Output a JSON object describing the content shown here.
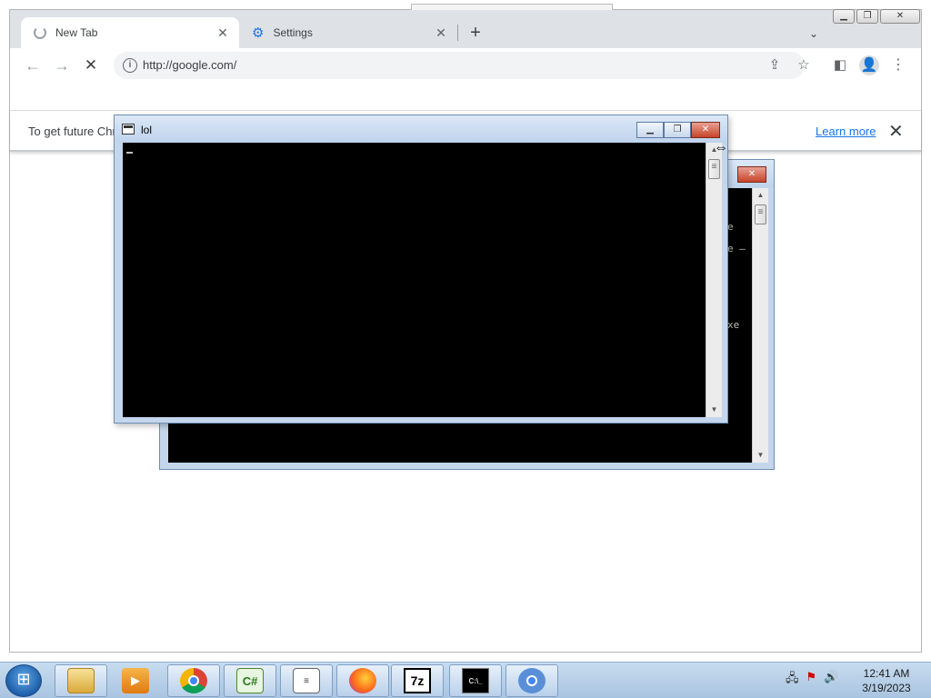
{
  "browser": {
    "tabs": [
      {
        "title": "New Tab",
        "loading": true
      },
      {
        "title": "Settings"
      }
    ],
    "url": "http://google.com/",
    "infobar": {
      "message": "To get future Chr",
      "link": "Learn more"
    }
  },
  "consoles": {
    "front": {
      "title": "lol"
    },
    "back": {
      "partial_lines": [
        "e",
        "e  —",
        "xe"
      ]
    }
  },
  "taskbar": {
    "apps": [
      "windows-explorer",
      "media-player",
      "chrome",
      "csharp-ide",
      "notepad-app",
      "firefox",
      "7zip",
      "command-prompt",
      "chromium"
    ],
    "clock": {
      "time": "12:41 AM",
      "date": "3/19/2023"
    }
  },
  "colors": {
    "chrome_tabstrip": "#dee1e6",
    "console_body": "#000000",
    "link": "#1a73e8",
    "taskbar": "#b9d0ea"
  }
}
